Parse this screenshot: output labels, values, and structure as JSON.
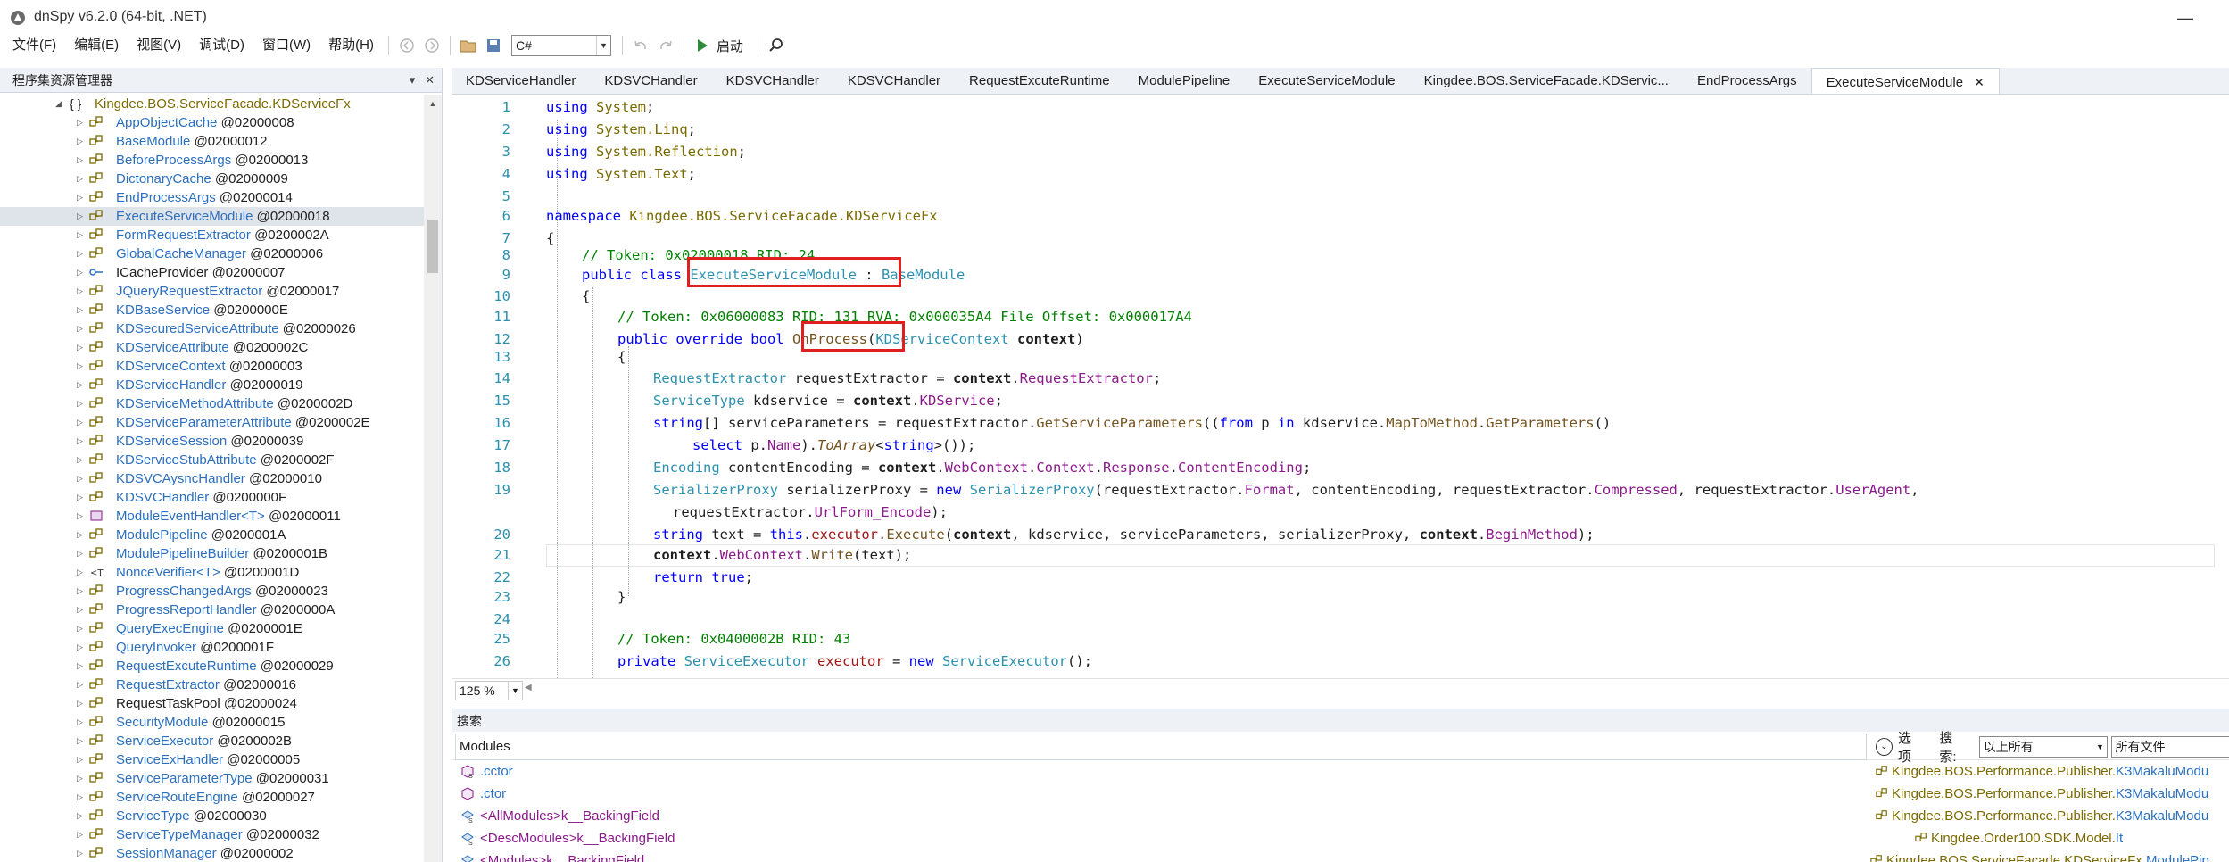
{
  "app": {
    "title": "dnSpy v6.2.0 (64-bit, .NET)"
  },
  "menu": [
    "文件(F)",
    "编辑(E)",
    "视图(V)",
    "调试(D)",
    "窗口(W)",
    "帮助(H)"
  ],
  "toolbar": {
    "language": "C#",
    "run_label": "启动"
  },
  "assembly_explorer": {
    "title": "程序集资源管理器",
    "namespace": "Kingdee.BOS.ServiceFacade.KDServiceFx",
    "items": [
      {
        "name": "AppObjectCache",
        "token": "@02000008",
        "icon": "class-icon"
      },
      {
        "name": "BaseModule",
        "token": "@02000012",
        "icon": "class-icon"
      },
      {
        "name": "BeforeProcessArgs",
        "token": "@02000013",
        "icon": "class-icon"
      },
      {
        "name": "DictonaryCache",
        "token": "@02000009",
        "icon": "class-icon"
      },
      {
        "name": "EndProcessArgs",
        "token": "@02000014",
        "icon": "class-icon"
      },
      {
        "name": "ExecuteServiceModule",
        "token": "@02000018",
        "icon": "class-icon",
        "selected": true
      },
      {
        "name": "FormRequestExtractor",
        "token": "@0200002A",
        "icon": "class-icon"
      },
      {
        "name": "GlobalCacheManager",
        "token": "@02000006",
        "icon": "class-icon"
      },
      {
        "name": "ICacheProvider",
        "token": "@02000007",
        "icon": "interface-icon"
      },
      {
        "name": "JQueryRequestExtractor",
        "token": "@02000017",
        "icon": "class-icon"
      },
      {
        "name": "KDBaseService",
        "token": "@0200000E",
        "icon": "class-icon"
      },
      {
        "name": "KDSecuredServiceAttribute",
        "token": "@02000026",
        "icon": "class-icon"
      },
      {
        "name": "KDServiceAttribute",
        "token": "@0200002C",
        "icon": "class-icon"
      },
      {
        "name": "KDServiceContext",
        "token": "@02000003",
        "icon": "class-icon"
      },
      {
        "name": "KDServiceHandler",
        "token": "@02000019",
        "icon": "class-icon"
      },
      {
        "name": "KDServiceMethodAttribute",
        "token": "@0200002D",
        "icon": "class-icon"
      },
      {
        "name": "KDServiceParameterAttribute",
        "token": "@0200002E",
        "icon": "class-icon"
      },
      {
        "name": "KDServiceSession",
        "token": "@02000039",
        "icon": "class-icon"
      },
      {
        "name": "KDServiceStubAttribute",
        "token": "@0200002F",
        "icon": "class-icon"
      },
      {
        "name": "KDSVCAysncHandler",
        "token": "@02000010",
        "icon": "class-icon"
      },
      {
        "name": "KDSVCHandler",
        "token": "@0200000F",
        "icon": "class-icon"
      },
      {
        "name": "ModuleEventHandler<T>",
        "token": "@02000011",
        "icon": "delegate-icon"
      },
      {
        "name": "ModulePipeline",
        "token": "@0200001A",
        "icon": "class-icon"
      },
      {
        "name": "ModulePipelineBuilder",
        "token": "@0200001B",
        "icon": "class-icon"
      },
      {
        "name": "NonceVerifier<T>",
        "token": "@0200001D",
        "icon": "generic-class-icon"
      },
      {
        "name": "ProgressChangedArgs",
        "token": "@02000023",
        "icon": "class-icon"
      },
      {
        "name": "ProgressReportHandler",
        "token": "@0200000A",
        "icon": "class-icon"
      },
      {
        "name": "QueryExecEngine",
        "token": "@0200001E",
        "icon": "class-icon"
      },
      {
        "name": "QueryInvoker",
        "token": "@0200001F",
        "icon": "class-icon"
      },
      {
        "name": "RequestExcuteRuntime",
        "token": "@02000029",
        "icon": "class-icon"
      },
      {
        "name": "RequestExtractor",
        "token": "@02000016",
        "icon": "class-icon"
      },
      {
        "name": "RequestTaskPool",
        "token": "@02000024",
        "icon": "class-icon"
      },
      {
        "name": "SecurityModule",
        "token": "@02000015",
        "icon": "class-icon"
      },
      {
        "name": "ServiceExecutor",
        "token": "@0200002B",
        "icon": "class-icon"
      },
      {
        "name": "ServiceExHandler",
        "token": "@02000005",
        "icon": "class-icon"
      },
      {
        "name": "ServiceParameterType",
        "token": "@02000031",
        "icon": "class-icon"
      },
      {
        "name": "ServiceRouteEngine",
        "token": "@02000027",
        "icon": "class-icon"
      },
      {
        "name": "ServiceType",
        "token": "@02000030",
        "icon": "class-icon"
      },
      {
        "name": "ServiceTypeManager",
        "token": "@02000032",
        "icon": "class-icon"
      },
      {
        "name": "SessionManager",
        "token": "@02000002",
        "icon": "class-icon"
      }
    ]
  },
  "tabs": [
    {
      "label": "KDServiceHandler"
    },
    {
      "label": "KDSVCHandler"
    },
    {
      "label": "KDSVCHandler"
    },
    {
      "label": "KDSVCHandler"
    },
    {
      "label": "RequestExcuteRuntime"
    },
    {
      "label": "ModulePipeline"
    },
    {
      "label": "ExecuteServiceModule"
    },
    {
      "label": "Kingdee.BOS.ServiceFacade.KDServic..."
    },
    {
      "label": "EndProcessArgs"
    },
    {
      "label": "ExecuteServiceModule",
      "active": true
    }
  ],
  "editor": {
    "zoom": "125 %",
    "line_numbers": [
      "1",
      "2",
      "3",
      "4",
      "5",
      "6",
      "7",
      "8",
      "9",
      "10",
      "11",
      "12",
      "13",
      "14",
      "15",
      "16",
      "17",
      "18",
      "19",
      "",
      "20",
      "21",
      "22",
      "23",
      "24",
      "25",
      "26"
    ],
    "lines": {
      "l1_kw": "using",
      "l1_ns": "System",
      "l1_end": ";",
      "l2_kw": "using",
      "l2_ns": "System.Linq",
      "l2_end": ";",
      "l3_kw": "using",
      "l3_ns": "System.Reflection",
      "l3_end": ";",
      "l4_kw": "using",
      "l4_ns": "System.Text",
      "l4_end": ";",
      "l6_kw": "namespace",
      "l6_ns": "Kingdee.BOS.ServiceFacade.KDServiceFx",
      "l7": "{",
      "l8": "// Token: 0x02000018 RID: 24",
      "l9_kw": "public class",
      "l9_ty": "ExecuteServiceModule",
      "l9_sep": " : ",
      "l9_base": "BaseModule",
      "l10": "{",
      "l11": "// Token: 0x06000083 RID: 131 RVA: 0x000035A4 File Offset: 0x000017A4",
      "l12_kw": "public override bool",
      "l12_me": "OnProcess",
      "l12_open": "(",
      "l12_ty": "KDServiceContext",
      "l12_pa": "context",
      "l12_close": ")",
      "l13": "{",
      "l14_ty": "RequestExtractor",
      "l14_var": " requestExtractor = ",
      "l14_pa": "context",
      "l14_dot": ".",
      "l14_pr": "RequestExtractor",
      "l14_end": ";",
      "l15_ty": "ServiceType",
      "l15_var": " kdservice = ",
      "l15_pa": "context",
      "l15_dot": ".",
      "l15_pr": "KDService",
      "l15_end": ";",
      "l16_kw": "string",
      "l16_a": "[] serviceParameters = requestExtractor.",
      "l16_me": "GetServiceParameters",
      "l16_b": "((",
      "l16_kw2": "from",
      "l16_c": " p ",
      "l16_kw3": "in",
      "l16_d": " kdservice.",
      "l16_me2": "MapToMethod",
      "l16_e": ".",
      "l16_me3": "GetParameters",
      "l16_f": "()",
      "l17_kw": "select",
      "l17_a": " p.",
      "l17_pr": "Name",
      "l17_b": ").",
      "l17_it": "ToArray",
      "l17_c": "<",
      "l17_kw2": "string",
      "l17_d": ">());",
      "l18_ty": "Encoding",
      "l18_a": " contentEncoding = ",
      "l18_pa": "context",
      "l18_b": ".",
      "l18_pr": "WebContext",
      "l18_c": ".",
      "l18_pr2": "Context",
      "l18_d": ".",
      "l18_pr3": "Response",
      "l18_e": ".",
      "l18_pr4": "ContentEncoding",
      "l18_f": ";",
      "l19_ty": "SerializerProxy",
      "l19_a": " serializerProxy = ",
      "l19_kw": "new",
      "l19_sp": " ",
      "l19_ty2": "SerializerProxy",
      "l19_b": "(requestExtractor.",
      "l19_pr": "Format",
      "l19_c": ", contentEncoding, requestExtractor.",
      "l19_pr2": "Compressed",
      "l19_d": ", requestExtractor.",
      "l19_pr3": "UserAgent",
      "l19_e": ",",
      "l19b_a": "requestExtractor.",
      "l19b_pr": "UrlForm_Encode",
      "l19b_b": ");",
      "l20_kw": "string",
      "l20_a": " text = ",
      "l20_kw2": "this",
      "l20_b": ".",
      "l20_fld": "executor",
      "l20_c": ".",
      "l20_me": "Execute",
      "l20_d": "(",
      "l20_pa": "context",
      "l20_e": ", kdservice, serviceParameters, serializerProxy, ",
      "l20_pa2": "context",
      "l20_f": ".",
      "l20_pr": "BeginMethod",
      "l20_g": ");",
      "l21_pa": "context",
      "l21_a": ".",
      "l21_pr": "WebContext",
      "l21_b": ".",
      "l21_me": "Write",
      "l21_c": "(text);",
      "l22_kw": "return true",
      "l22_end": ";",
      "l23": "}",
      "l25": "// Token: 0x0400002B RID: 43",
      "l26_kw": "private",
      "l26_sp": " ",
      "l26_ty": "ServiceExecutor",
      "l26_sp2": " ",
      "l26_fld": "executor",
      "l26_a": " = ",
      "l26_kw2": "new",
      "l26_sp3": " ",
      "l26_ty2": "ServiceExecutor",
      "l26_b": "();"
    }
  },
  "search": {
    "title": "搜索",
    "modules_label": "Modules",
    "options_label": "选项",
    "search_label": "搜索:",
    "scope_value": "以上所有",
    "files_value": "所有文件",
    "results": [
      {
        "name": ".cctor",
        "kind": "ctor",
        "loc_ns": "Kingdee.BOS.Performance.Publisher.",
        "loc_cls": "K3MakaluModu",
        "icon": "method-static-icon"
      },
      {
        "name": ".ctor",
        "kind": "ctor",
        "loc_ns": "Kingdee.BOS.Performance.Publisher.",
        "loc_cls": "K3MakaluModu",
        "icon": "method-icon"
      },
      {
        "name": "<AllModules>k__BackingField",
        "kind": "field",
        "loc_ns": "Kingdee.BOS.Performance.Publisher.",
        "loc_cls": "K3MakaluModu",
        "icon": "field-static-icon"
      },
      {
        "name": "<DescModules>k__BackingField",
        "kind": "field",
        "loc_ns": "Kingdee.Order100.SDK.Model.",
        "loc_cls": "It",
        "icon": "field-static-icon"
      },
      {
        "name": "<Modules>k__BackingField",
        "kind": "field",
        "loc_ns": "Kingdee.BOS.ServiceFacade.KDServiceFx.",
        "loc_cls": "ModulePip",
        "icon": "field-icon"
      }
    ]
  },
  "colors": {
    "accent_red": "#e02020",
    "keyword": "#0000ff",
    "type": "#2b91af",
    "comment": "#008000"
  }
}
